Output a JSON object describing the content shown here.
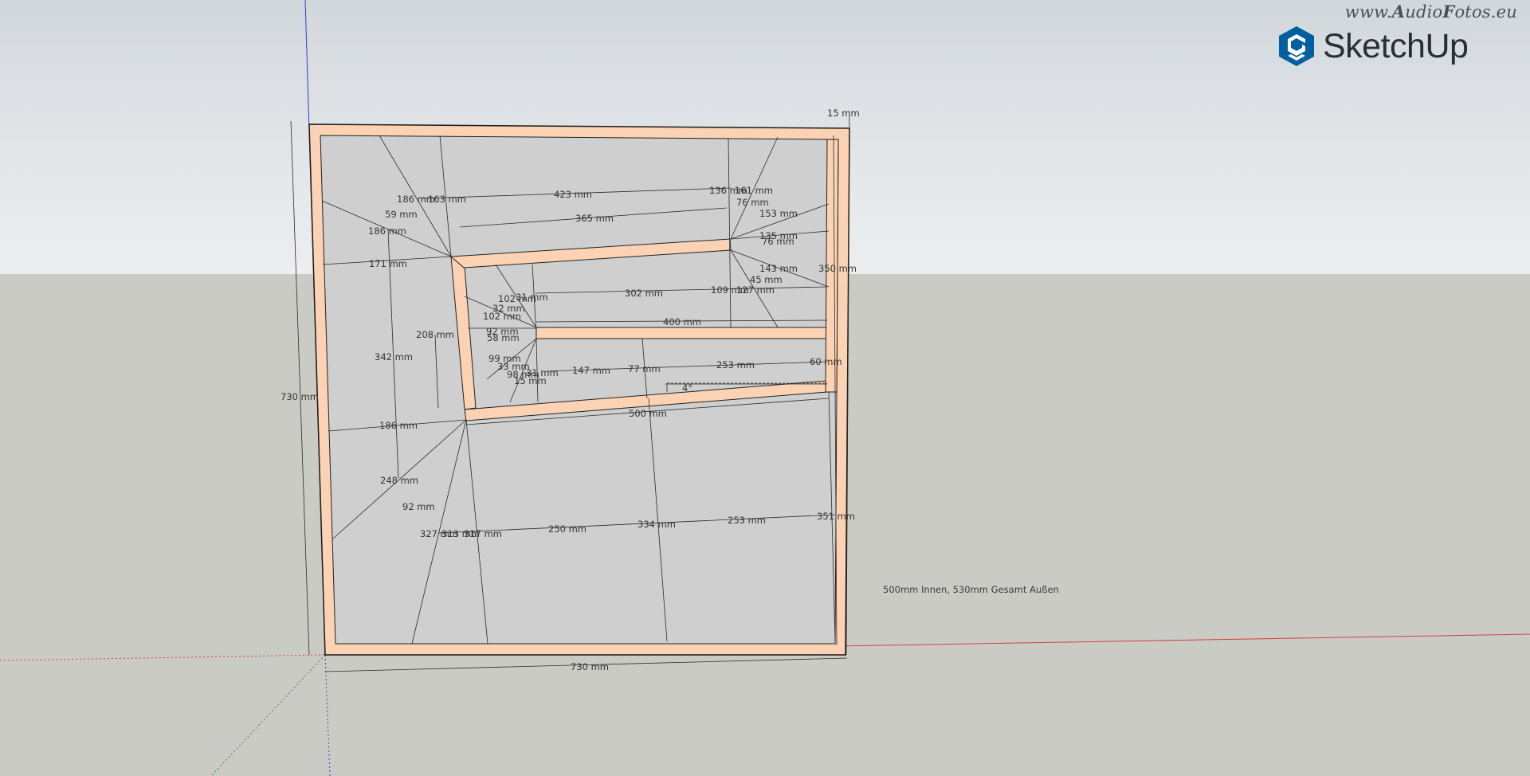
{
  "app": {
    "name": "SketchUp",
    "watermark_parts": [
      "www.",
      "A",
      "udio",
      "F",
      "otos.eu"
    ],
    "note": "500mm Innen, 530mm Gesamt Außen"
  },
  "colors": {
    "sky": "#dde1e4",
    "ground": "#cbcbc6",
    "panel_fill": "#cfcfcf",
    "board": "#fbd3b4",
    "edge": "#1a1a1a",
    "axis_red": "#d04040",
    "axis_green": "#3c8c3c",
    "axis_blue": "#3030c0",
    "logo_blue": "#005f9e"
  },
  "dimensions": [
    {
      "id": "dim-1",
      "text": "15 mm"
    },
    {
      "id": "dim-2",
      "text": "423 mm"
    },
    {
      "id": "dim-3",
      "text": "186 mm"
    },
    {
      "id": "dim-4",
      "text": "163 mm"
    },
    {
      "id": "dim-5",
      "text": "59 mm"
    },
    {
      "id": "dim-6",
      "text": "186 mm"
    },
    {
      "id": "dim-7",
      "text": "365 mm"
    },
    {
      "id": "dim-8",
      "text": "136 mm"
    },
    {
      "id": "dim-9",
      "text": "161 mm"
    },
    {
      "id": "dim-10",
      "text": "76 mm"
    },
    {
      "id": "dim-11",
      "text": "153 mm"
    },
    {
      "id": "dim-12",
      "text": "135 mm"
    },
    {
      "id": "dim-13",
      "text": "76 mm"
    },
    {
      "id": "dim-14",
      "text": "171 mm"
    },
    {
      "id": "dim-15",
      "text": "143 mm"
    },
    {
      "id": "dim-16",
      "text": "350 mm"
    },
    {
      "id": "dim-17",
      "text": "45 mm"
    },
    {
      "id": "dim-18",
      "text": "302 mm"
    },
    {
      "id": "dim-19",
      "text": "109 mm"
    },
    {
      "id": "dim-20",
      "text": "127 mm"
    },
    {
      "id": "dim-21",
      "text": "102 mm"
    },
    {
      "id": "dim-22",
      "text": "31 mm"
    },
    {
      "id": "dim-23",
      "text": "32 mm"
    },
    {
      "id": "dim-24",
      "text": "102 mm"
    },
    {
      "id": "dim-25",
      "text": "400 mm"
    },
    {
      "id": "dim-26",
      "text": "208 mm"
    },
    {
      "id": "dim-27",
      "text": "92 mm"
    },
    {
      "id": "dim-28",
      "text": "58 mm"
    },
    {
      "id": "dim-29",
      "text": "342 mm"
    },
    {
      "id": "dim-30",
      "text": "99 mm"
    },
    {
      "id": "dim-31",
      "text": "33 mm"
    },
    {
      "id": "dim-32",
      "text": "98 mm"
    },
    {
      "id": "dim-33",
      "text": "31 mm"
    },
    {
      "id": "dim-34",
      "text": "147 mm"
    },
    {
      "id": "dim-35",
      "text": "77 mm"
    },
    {
      "id": "dim-36",
      "text": "253 mm"
    },
    {
      "id": "dim-37",
      "text": "60 mm"
    },
    {
      "id": "dim-38",
      "text": "15 mm"
    },
    {
      "id": "dim-39",
      "text": "4°"
    },
    {
      "id": "dim-40",
      "text": "730 mm"
    },
    {
      "id": "dim-41",
      "text": "500 mm"
    },
    {
      "id": "dim-42",
      "text": "186 mm"
    },
    {
      "id": "dim-43",
      "text": "248 mm"
    },
    {
      "id": "dim-44",
      "text": "92 mm"
    },
    {
      "id": "dim-45",
      "text": "327 mm"
    },
    {
      "id": "dim-46",
      "text": "313 mm"
    },
    {
      "id": "dim-47",
      "text": "317 mm"
    },
    {
      "id": "dim-48",
      "text": "250 mm"
    },
    {
      "id": "dim-49",
      "text": "334 mm"
    },
    {
      "id": "dim-50",
      "text": "253 mm"
    },
    {
      "id": "dim-51",
      "text": "351 mm"
    },
    {
      "id": "dim-52",
      "text": "730 mm"
    }
  ]
}
